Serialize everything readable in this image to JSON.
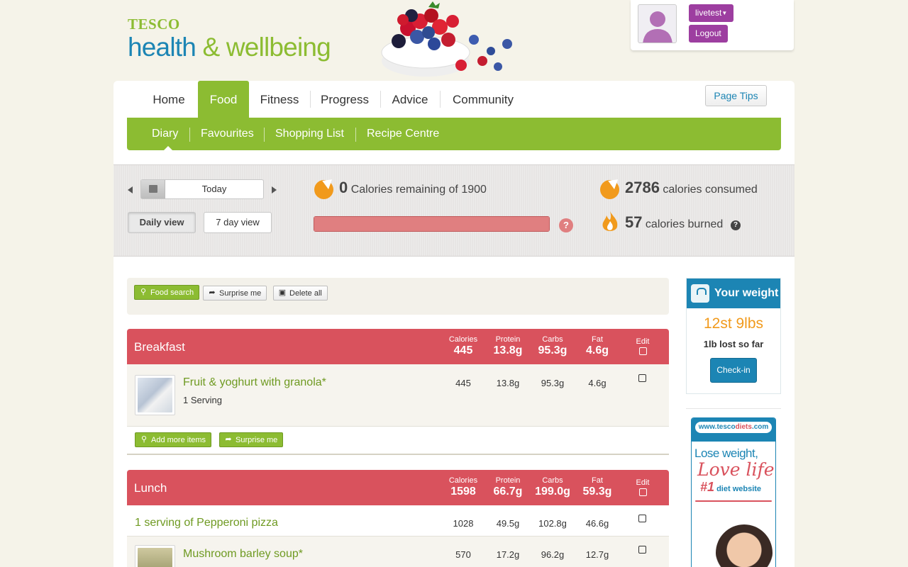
{
  "header": {
    "brand": "TESCO",
    "title_part1": "health ",
    "title_amp": "&",
    "title_part2": " wellbeing"
  },
  "user": {
    "username": "livetest",
    "logout": "Logout"
  },
  "nav": {
    "items": [
      "Home",
      "Food",
      "Fitness",
      "Progress",
      "Advice",
      "Community"
    ],
    "active": "Food",
    "page_tips": "Page Tips"
  },
  "subnav": {
    "items": [
      "Diary",
      "Favourites",
      "Shopping List",
      "Recipe Centre"
    ],
    "active": "Diary"
  },
  "summary": {
    "date": "Today",
    "daily_view": "Daily view",
    "seven_day_view": "7 day view",
    "remaining_value": "0",
    "remaining_text": " Calories remaining of 1900",
    "consumed_value": "2786",
    "consumed_text": " calories consumed",
    "burned_value": "57",
    "burned_text": " calories burned",
    "progress_fraction": 1.0,
    "help_glyph": "?"
  },
  "toolbar": {
    "food_search": "Food search",
    "surprise_me": "Surprise me",
    "delete_all": "Delete all"
  },
  "columns": {
    "calories": "Calories",
    "protein": "Protein",
    "carbs": "Carbs",
    "fat": "Fat",
    "edit": "Edit"
  },
  "breakfast": {
    "name": "Breakfast",
    "calories": "445",
    "protein": "13.8g",
    "carbs": "95.3g",
    "fat": "4.6g",
    "items": [
      {
        "name": "Fruit & yoghurt with granola*",
        "serving": "1 Serving",
        "calories": "445",
        "protein": "13.8g",
        "carbs": "95.3g",
        "fat": "4.6g"
      }
    ],
    "add_more": "Add more items",
    "surprise_me": "Surprise me"
  },
  "lunch": {
    "name": "Lunch",
    "calories": "1598",
    "protein": "66.7g",
    "carbs": "199.0g",
    "fat": "59.3g",
    "items": [
      {
        "name": "1 serving of Pepperoni pizza",
        "calories": "1028",
        "protein": "49.5g",
        "carbs": "102.8g",
        "fat": "46.6g"
      },
      {
        "name": "Mushroom barley soup*",
        "calories": "570",
        "protein": "17.2g",
        "carbs": "96.2g",
        "fat": "12.7g"
      }
    ]
  },
  "weight": {
    "title": "Your weight",
    "value": "12st 9lbs",
    "lost": "1lb lost so far",
    "checkin": "Check-in"
  },
  "ad": {
    "url_pre": "www.tesco",
    "url_diets": "diets",
    "url_post": ".com",
    "line1": "Lose weight,",
    "line2": "Love life",
    "rank": "#1",
    "rank_text": " diet website"
  },
  "colors": {
    "brand_green": "#8cbc32",
    "brand_blue": "#1c85b4",
    "meal_red": "#d9525d",
    "accent_orange": "#f19a1c",
    "user_purple": "#9d3ea0"
  }
}
